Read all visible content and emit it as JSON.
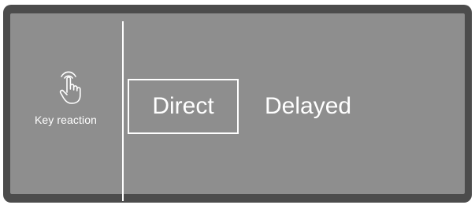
{
  "sidebar": {
    "icon": "touch-hand-icon",
    "label": "Key reaction"
  },
  "options": {
    "items": [
      {
        "label": "Direct",
        "selected": true
      },
      {
        "label": "Delayed",
        "selected": false
      }
    ]
  },
  "colors": {
    "bezel": "#4c4c4c",
    "screen": "#8e8e8e",
    "foreground": "#ffffff"
  }
}
